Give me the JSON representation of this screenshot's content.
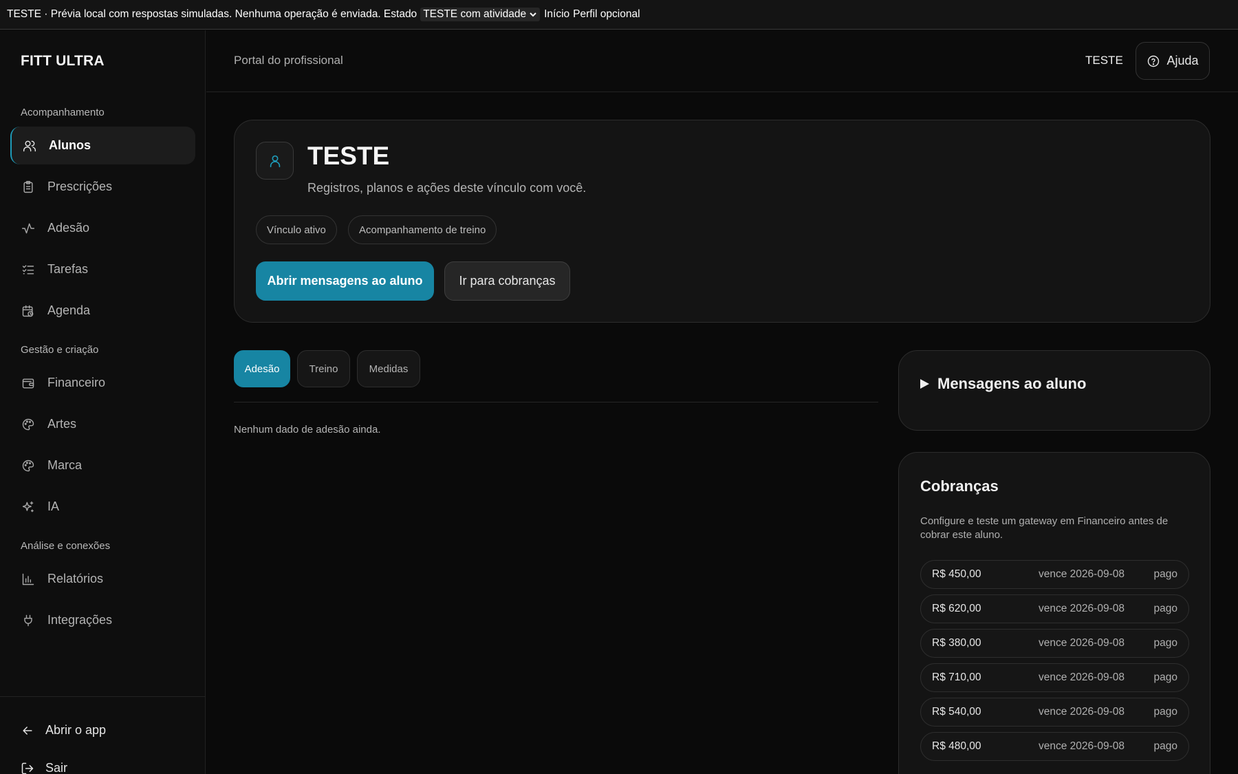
{
  "testbar": {
    "text": "TESTE · Prévia local com respostas simuladas. Nenhuma operação é enviada. Estado",
    "state_value": "TESTE com atividade",
    "link_inicio": "Início",
    "link_perfil": "Perfil opcional"
  },
  "sidebar": {
    "brand": "FITT ULTRA",
    "sections": [
      {
        "title": "Acompanhamento"
      },
      {
        "title": "Gestão e criação"
      },
      {
        "title": "Análise e conexões"
      }
    ],
    "items": [
      {
        "label": "Alunos",
        "icon": "users-icon"
      },
      {
        "label": "Prescrições",
        "icon": "clipboard-icon"
      },
      {
        "label": "Adesão",
        "icon": "activity-icon"
      },
      {
        "label": "Tarefas",
        "icon": "checklist-icon"
      },
      {
        "label": "Agenda",
        "icon": "calendar-clock-icon"
      },
      {
        "label": "Financeiro",
        "icon": "wallet-icon"
      },
      {
        "label": "Artes",
        "icon": "palette-icon"
      },
      {
        "label": "Marca",
        "icon": "palette-icon"
      },
      {
        "label": "IA",
        "icon": "sparkles-icon"
      },
      {
        "label": "Relatórios",
        "icon": "bar-chart-icon"
      },
      {
        "label": "Integrações",
        "icon": "plug-icon"
      }
    ],
    "footer": {
      "open_app": "Abrir o app",
      "logout": "Sair"
    }
  },
  "header": {
    "portal_title": "Portal do profissional",
    "user_name": "TESTE",
    "help_label": "Ajuda"
  },
  "profile": {
    "name": "TESTE",
    "description": "Registros, planos e ações deste vínculo com você.",
    "chips": [
      "Vínculo ativo",
      "Acompanhamento de treino"
    ],
    "primary_action": "Abrir mensagens ao aluno",
    "secondary_action": "Ir para cobranças"
  },
  "tabs": {
    "items": [
      "Adesão",
      "Treino",
      "Medidas"
    ],
    "active": "Adesão",
    "empty_message": "Nenhum dado de adesão ainda."
  },
  "messages": {
    "title": "Mensagens ao aluno"
  },
  "charges": {
    "title": "Cobranças",
    "note": "Configure e teste um gateway em Financeiro antes de cobrar este aluno.",
    "rows": [
      {
        "amount": "R$ 450,00",
        "due": "vence 2026-09-08",
        "status": "pago"
      },
      {
        "amount": "R$ 620,00",
        "due": "vence 2026-09-08",
        "status": "pago"
      },
      {
        "amount": "R$ 380,00",
        "due": "vence 2026-09-08",
        "status": "pago"
      },
      {
        "amount": "R$ 710,00",
        "due": "vence 2026-09-08",
        "status": "pago"
      },
      {
        "amount": "R$ 540,00",
        "due": "vence 2026-09-08",
        "status": "pago"
      },
      {
        "amount": "R$ 480,00",
        "due": "vence 2026-09-08",
        "status": "pago"
      }
    ]
  },
  "colors": {
    "accent": "#1785a3",
    "background": "#0a0a0a",
    "card": "#141414"
  }
}
